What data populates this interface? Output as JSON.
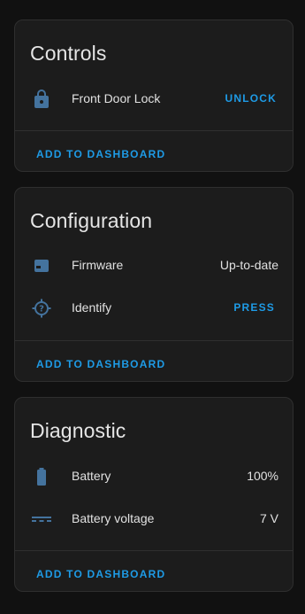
{
  "colors": {
    "background": "#111111",
    "card": "#1c1c1c",
    "accent": "#1e9be6",
    "icon": "#44739e"
  },
  "controls": {
    "title": "Controls",
    "rows": [
      {
        "icon": "lock-icon",
        "label": "Front Door Lock",
        "action": "UNLOCK"
      }
    ],
    "footer": "ADD TO DASHBOARD"
  },
  "configuration": {
    "title": "Configuration",
    "rows": [
      {
        "icon": "firmware-icon",
        "label": "Firmware",
        "value": "Up-to-date"
      },
      {
        "icon": "identify-icon",
        "label": "Identify",
        "action": "PRESS"
      }
    ],
    "footer": "ADD TO DASHBOARD"
  },
  "diagnostic": {
    "title": "Diagnostic",
    "rows": [
      {
        "icon": "battery-icon",
        "label": "Battery",
        "value": "100%"
      },
      {
        "icon": "voltage-icon",
        "label": "Battery voltage",
        "value": "7 V"
      }
    ],
    "footer": "ADD TO DASHBOARD"
  }
}
